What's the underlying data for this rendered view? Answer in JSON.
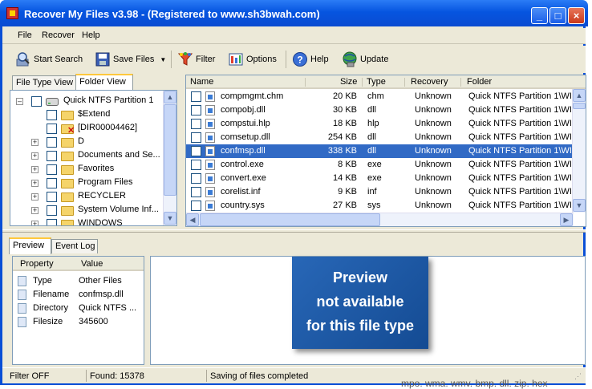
{
  "window": {
    "title": "Recover My Files v3.98  -  (Registered to www.sh3bwah.com)"
  },
  "menu": [
    "File",
    "Recover",
    "Help"
  ],
  "toolbar": {
    "start_search": "Start Search",
    "save_files": "Save Files",
    "filter": "Filter",
    "options": "Options",
    "help": "Help",
    "update": "Update"
  },
  "left_tabs": [
    "File Type View",
    "Folder View"
  ],
  "tree": [
    {
      "label": "Quick NTFS Partition 1",
      "icon": "drive-icon",
      "expander": "minus"
    },
    {
      "label": "$Extend",
      "icon": "folder-icon",
      "expander": "none"
    },
    {
      "label": "[DIR00004462]",
      "icon": "deleted-folder-icon",
      "expander": "none"
    },
    {
      "label": "D",
      "icon": "folder-icon",
      "expander": "plus"
    },
    {
      "label": "Documents and Se...",
      "icon": "folder-icon",
      "expander": "plus"
    },
    {
      "label": "Favorites",
      "icon": "folder-icon",
      "expander": "plus"
    },
    {
      "label": "Program Files",
      "icon": "folder-icon",
      "expander": "plus"
    },
    {
      "label": "RECYCLER",
      "icon": "folder-icon",
      "expander": "plus"
    },
    {
      "label": "System Volume Inf...",
      "icon": "folder-icon",
      "expander": "plus"
    },
    {
      "label": "WINDOWS",
      "icon": "folder-icon",
      "expander": "plus"
    }
  ],
  "file_list": {
    "columns": [
      "Name",
      "Size",
      "Type",
      "Recovery",
      "Folder"
    ],
    "rows": [
      {
        "name": "compmgmt.chm",
        "size": "20 KB",
        "type": "chm",
        "recovery": "Unknown",
        "folder": "Quick NTFS Partition 1\\WI"
      },
      {
        "name": "compobj.dll",
        "size": "30 KB",
        "type": "dll",
        "recovery": "Unknown",
        "folder": "Quick NTFS Partition 1\\WI"
      },
      {
        "name": "compstui.hlp",
        "size": "18 KB",
        "type": "hlp",
        "recovery": "Unknown",
        "folder": "Quick NTFS Partition 1\\WI"
      },
      {
        "name": "comsetup.dll",
        "size": "254 KB",
        "type": "dll",
        "recovery": "Unknown",
        "folder": "Quick NTFS Partition 1\\WI"
      },
      {
        "name": "confmsp.dll",
        "size": "338 KB",
        "type": "dll",
        "recovery": "Unknown",
        "folder": "Quick NTFS Partition 1\\WI"
      },
      {
        "name": "control.exe",
        "size": "8 KB",
        "type": "exe",
        "recovery": "Unknown",
        "folder": "Quick NTFS Partition 1\\WI"
      },
      {
        "name": "convert.exe",
        "size": "14 KB",
        "type": "exe",
        "recovery": "Unknown",
        "folder": "Quick NTFS Partition 1\\WI"
      },
      {
        "name": "corelist.inf",
        "size": "9 KB",
        "type": "inf",
        "recovery": "Unknown",
        "folder": "Quick NTFS Partition 1\\WI"
      },
      {
        "name": "country.sys",
        "size": "27 KB",
        "type": "sys",
        "recovery": "Unknown",
        "folder": "Quick NTFS Partition 1\\WI"
      }
    ],
    "selected": "confmsp.dll"
  },
  "bottom_tabs": [
    "Preview",
    "Event Log"
  ],
  "properties": {
    "columns": [
      "Property",
      "Value"
    ],
    "rows": [
      {
        "property": "Type",
        "value": "Other Files"
      },
      {
        "property": "Filename",
        "value": "confmsp.dll"
      },
      {
        "property": "Directory",
        "value": "Quick NTFS ..."
      },
      {
        "property": "Filesize",
        "value": "345600"
      }
    ]
  },
  "preview": {
    "lines": [
      "Preview",
      "not available",
      "for this file type"
    ]
  },
  "status": {
    "filter": "Filter OFF",
    "found": "Found: 15378",
    "message": "Saving of files completed"
  },
  "background_text": "mpo. wma. wmv. bmp. dll. zip. hex",
  "colors": {
    "title_bar": "#0655e0",
    "selection": "#316ac5",
    "preview_box": "#1d5aa6"
  }
}
